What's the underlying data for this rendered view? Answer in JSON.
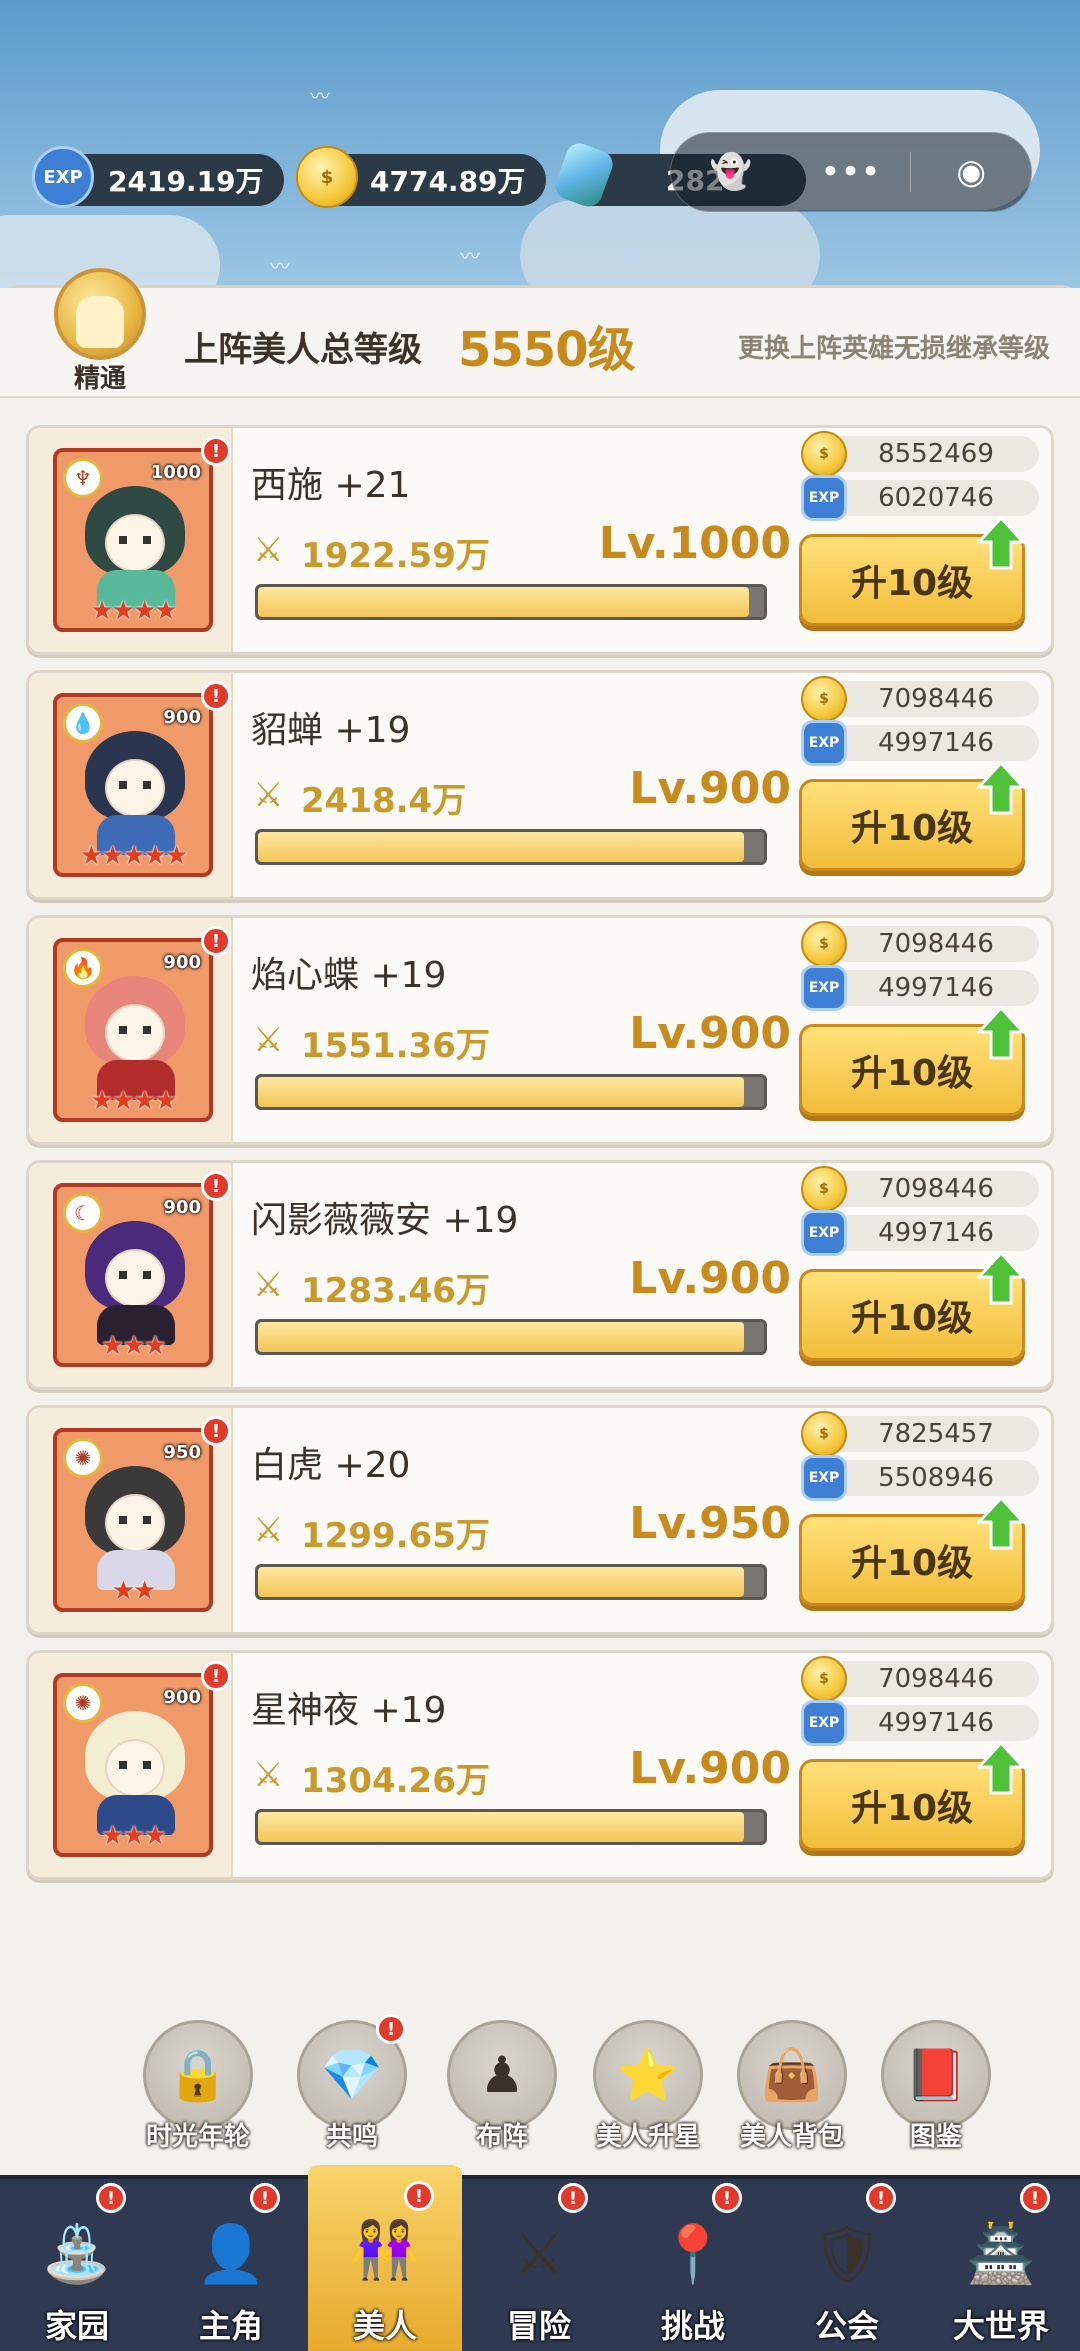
{
  "resources": {
    "exp_icon_label": "EXP",
    "exp": "2419.19万",
    "gold": "4774.89万",
    "gem": "2820"
  },
  "capsule": {
    "more": "•••"
  },
  "header": {
    "medal_label": "精通",
    "label": "上阵美人总等级",
    "total_level": "5550级",
    "tip": "更换上阵英雄无损继承等级"
  },
  "upgrade_label": "升10级",
  "exp_label": "EXP",
  "heroes": [
    {
      "name": "西施 +21",
      "power": "1922.59万",
      "level": "Lv.1000",
      "badge": "1000",
      "stars": "★★★★",
      "gold_cost": "8552469",
      "exp_cost": "6020746",
      "progress": 0.97,
      "hair": "#2f4a42",
      "body": "#58b89a",
      "frame": "#f09a6a",
      "elem": "♆"
    },
    {
      "name": "貂蝉 +19",
      "power": "2418.4万",
      "level": "Lv.900",
      "badge": "900",
      "stars": "★★★★★",
      "gold_cost": "7098446",
      "exp_cost": "4997146",
      "progress": 0.96,
      "hair": "#2a3550",
      "body": "#3e6bb5",
      "frame": "#f09a6a",
      "elem": "💧"
    },
    {
      "name": "焰心蝶 +19",
      "power": "1551.36万",
      "level": "Lv.900",
      "badge": "900",
      "stars": "★★★★",
      "gold_cost": "7098446",
      "exp_cost": "4997146",
      "progress": 0.96,
      "hair": "#e8857a",
      "body": "#b22c2c",
      "frame": "#f09a6a",
      "elem": "🔥"
    },
    {
      "name": "闪影薇薇安 +19",
      "power": "1283.46万",
      "level": "Lv.900",
      "badge": "900",
      "stars": "★★★",
      "gold_cost": "7098446",
      "exp_cost": "4997146",
      "progress": 0.96,
      "hair": "#4a2a7a",
      "body": "#2a2030",
      "frame": "#f09a6a",
      "elem": "☾"
    },
    {
      "name": "白虎 +20",
      "power": "1299.65万",
      "level": "Lv.950",
      "badge": "950",
      "stars": "★★",
      "gold_cost": "7825457",
      "exp_cost": "5508946",
      "progress": 0.96,
      "hair": "#3a3a3a",
      "body": "#d8d8e8",
      "frame": "#f09a6a",
      "elem": "✺"
    },
    {
      "name": "星神夜 +19",
      "power": "1304.26万",
      "level": "Lv.900",
      "badge": "900",
      "stars": "★★★",
      "gold_cost": "7098446",
      "exp_cost": "4997146",
      "progress": 0.96,
      "hair": "#f3edd2",
      "body": "#2f4a8a",
      "frame": "#f09a6a",
      "elem": "✺"
    }
  ],
  "functions": [
    {
      "label": "时光年轮",
      "icon": "lock-icon",
      "glyph": "🔒",
      "notif": false
    },
    {
      "label": "共鸣",
      "icon": "crystal-icon",
      "glyph": "💎",
      "notif": true
    },
    {
      "label": "布阵",
      "icon": "pawn-icon",
      "glyph": "♟",
      "notif": false
    },
    {
      "label": "美人升星",
      "icon": "star-icon",
      "glyph": "⭐",
      "notif": false
    },
    {
      "label": "美人背包",
      "icon": "bag-icon",
      "glyph": "👜",
      "notif": false
    },
    {
      "label": "图鉴",
      "icon": "book-icon",
      "glyph": "📕",
      "notif": false
    }
  ],
  "nav": [
    {
      "label": "家园",
      "icon": "home-pool-icon",
      "glyph": "⛲",
      "active": false
    },
    {
      "label": "主角",
      "icon": "hero-avatar-icon",
      "glyph": "👤",
      "active": false
    },
    {
      "label": "美人",
      "icon": "beauties-icon",
      "glyph": "👭",
      "active": true
    },
    {
      "label": "冒险",
      "icon": "sword-shield-icon",
      "glyph": "⚔",
      "active": false
    },
    {
      "label": "挑战",
      "icon": "map-pin-icon",
      "glyph": "📍",
      "active": false
    },
    {
      "label": "公会",
      "icon": "guild-shield-icon",
      "glyph": "🛡",
      "active": false
    },
    {
      "label": "大世界",
      "icon": "tower-icon",
      "glyph": "🏯",
      "active": false
    }
  ],
  "colors": {
    "accent": "#c98a1c",
    "button": "#f2bd3a",
    "notif": "#e23a2a",
    "nav_bg": "#2f3a52"
  }
}
